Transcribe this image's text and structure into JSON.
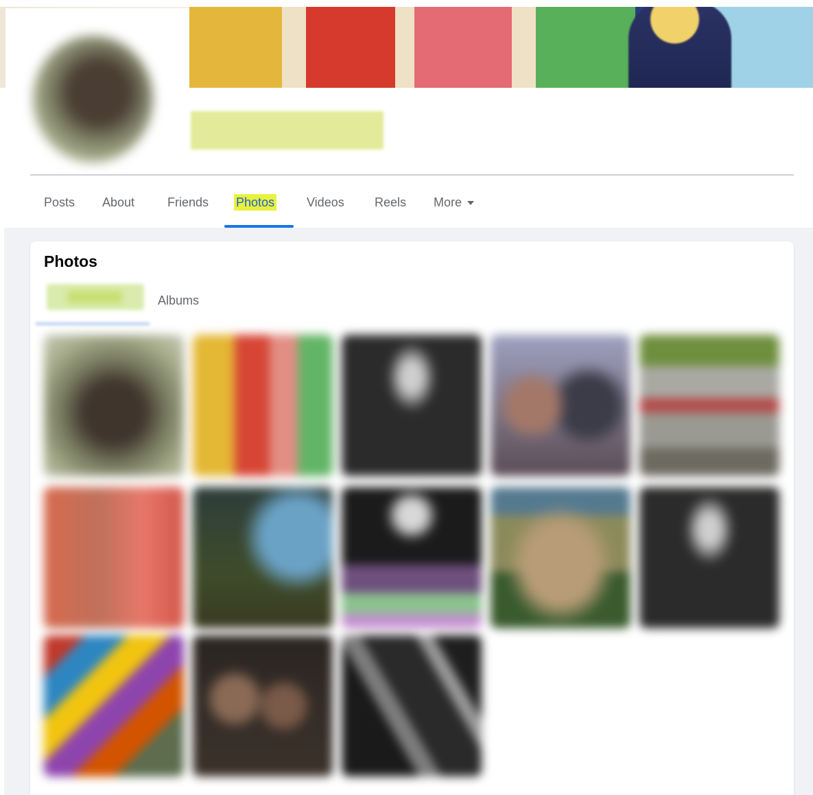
{
  "profile": {
    "name": "",
    "avatar_icon": "profile-photo"
  },
  "tabs": [
    {
      "label": "Posts"
    },
    {
      "label": "About"
    },
    {
      "label": "Friends"
    },
    {
      "label": "Photos",
      "active": true
    },
    {
      "label": "Videos"
    },
    {
      "label": "Reels"
    },
    {
      "label": "More"
    }
  ],
  "photos_card": {
    "title": "Photos",
    "subtabs": [
      {
        "label": "",
        "active": true
      },
      {
        "label": "Albums"
      }
    ]
  },
  "photo_grid": {
    "count": 13
  },
  "colors": {
    "accent": "#1b74e4",
    "highlight": "#e8f23e",
    "page_background": "#f0f2f5",
    "muted_text": "#65676b"
  }
}
